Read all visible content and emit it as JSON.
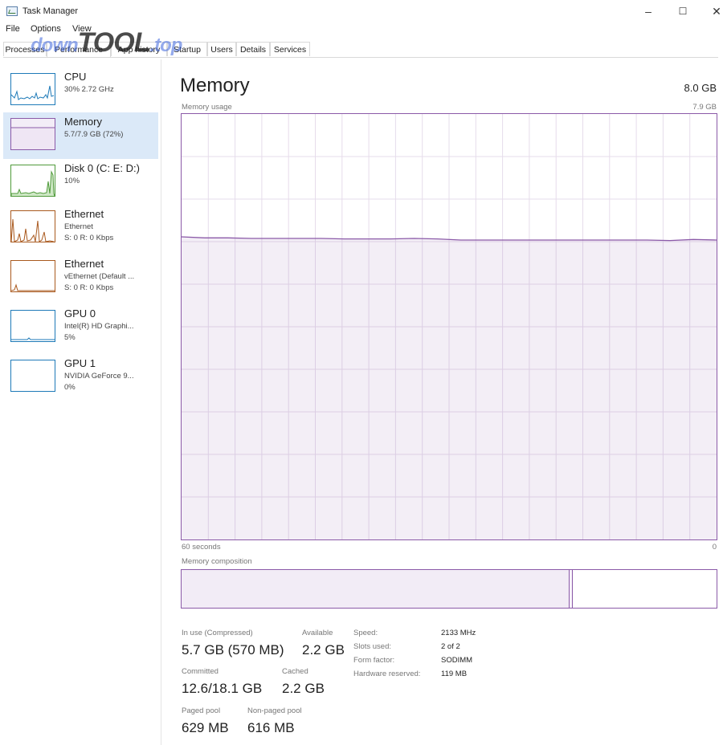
{
  "window": {
    "title": "Task Manager",
    "controls": [
      "–",
      "☐",
      "✕"
    ]
  },
  "menu": [
    "File",
    "Options",
    "View"
  ],
  "tabs": [
    "Processes",
    "Performance",
    "App history",
    "Startup",
    "Users",
    "Details",
    "Services"
  ],
  "active_tab": "Performance",
  "watermark": {
    "prefix": "down",
    "brand": "TOOL",
    "suffix": ".top"
  },
  "sidebar": [
    {
      "name": "CPU",
      "line1": "30% 2.72 GHz",
      "line2": "",
      "color": "#1e7ab8"
    },
    {
      "name": "Memory",
      "line1": "5.7/7.9 GB (72%)",
      "line2": "",
      "color": "#8b5aa8"
    },
    {
      "name": "Disk 0 (C: E: D:)",
      "line1": "10%",
      "line2": "",
      "color": "#4f9a3a"
    },
    {
      "name": "Ethernet",
      "line1": "Ethernet",
      "line2": "S: 0 R: 0 Kbps",
      "color": "#a9591e"
    },
    {
      "name": "Ethernet",
      "line1": "vEthernet (Default ...",
      "line2": "S: 0 R: 0 Kbps",
      "color": "#a9591e"
    },
    {
      "name": "GPU 0",
      "line1": "Intel(R) HD Graphi...",
      "line2": "5%",
      "color": "#1e7ab8"
    },
    {
      "name": "GPU 1",
      "line1": "NVIDIA GeForce 9...",
      "line2": "0%",
      "color": "#1e7ab8"
    }
  ],
  "main": {
    "title": "Memory",
    "total": "8.0 GB",
    "usage_label": "Memory usage",
    "usage_max": "7.9 GB",
    "axis_left": "60 seconds",
    "axis_right": "0",
    "composition_label": "Memory composition"
  },
  "usage_graph": {
    "max_gb": 7.9,
    "values_gb": [
      5.62,
      5.6,
      5.6,
      5.59,
      5.59,
      5.59,
      5.59,
      5.58,
      5.58,
      5.58,
      5.59,
      5.58,
      5.56,
      5.56,
      5.56,
      5.56,
      5.56,
      5.56,
      5.56,
      5.56,
      5.56,
      5.55,
      5.57,
      5.56
    ]
  },
  "stats": {
    "in_use_label": "In use (Compressed)",
    "in_use": "5.7 GB (570 MB)",
    "available_label": "Available",
    "available": "2.2 GB",
    "committed_label": "Committed",
    "committed": "12.6/18.1 GB",
    "cached_label": "Cached",
    "cached": "2.2 GB",
    "paged_label": "Paged pool",
    "paged": "629 MB",
    "nonpaged_label": "Non-paged pool",
    "nonpaged": "616 MB"
  },
  "details": [
    {
      "key": "Speed:",
      "value": "2133 MHz"
    },
    {
      "key": "Slots used:",
      "value": "2 of 2"
    },
    {
      "key": "Form factor:",
      "value": "SODIMM"
    },
    {
      "key": "Hardware reserved:",
      "value": "119 MB"
    }
  ]
}
